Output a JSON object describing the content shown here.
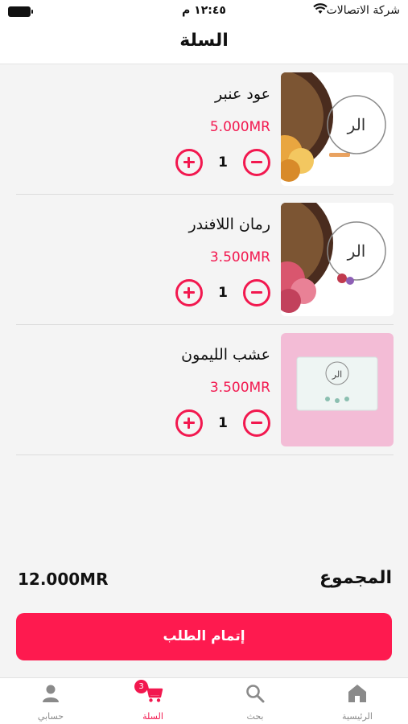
{
  "status": {
    "carrier": "شركة الاتصالات",
    "time": "١٢:٤٥ م"
  },
  "header": {
    "title": "السلة"
  },
  "cart": {
    "items": [
      {
        "name": "عود عنبر",
        "price": "5.000MR",
        "quantity": "1",
        "image": "oud-amber-product-photo"
      },
      {
        "name": "رمان اللافندر",
        "price": "3.500MR",
        "quantity": "1",
        "image": "pomegranate-lavender-product-photo"
      },
      {
        "name": "عشب الليمون",
        "price": "3.500MR",
        "quantity": "1",
        "image": "lemongrass-product-photo"
      }
    ]
  },
  "summary": {
    "total_label": "المجموع",
    "total_value": "12.000MR"
  },
  "checkout": {
    "label": "إتمام الطلب"
  },
  "tabbar": {
    "items": [
      {
        "label": "الرئيسية",
        "icon": "home-icon"
      },
      {
        "label": "بحث",
        "icon": "search-icon"
      },
      {
        "label": "السلة",
        "icon": "cart-icon",
        "badge": "3",
        "active": true
      },
      {
        "label": "حسابي",
        "icon": "person-icon"
      }
    ]
  },
  "colors": {
    "accent": "#f2184f",
    "button": "#fe1a4f",
    "inactive": "#8a8a8a",
    "background": "#f4f4f4"
  }
}
